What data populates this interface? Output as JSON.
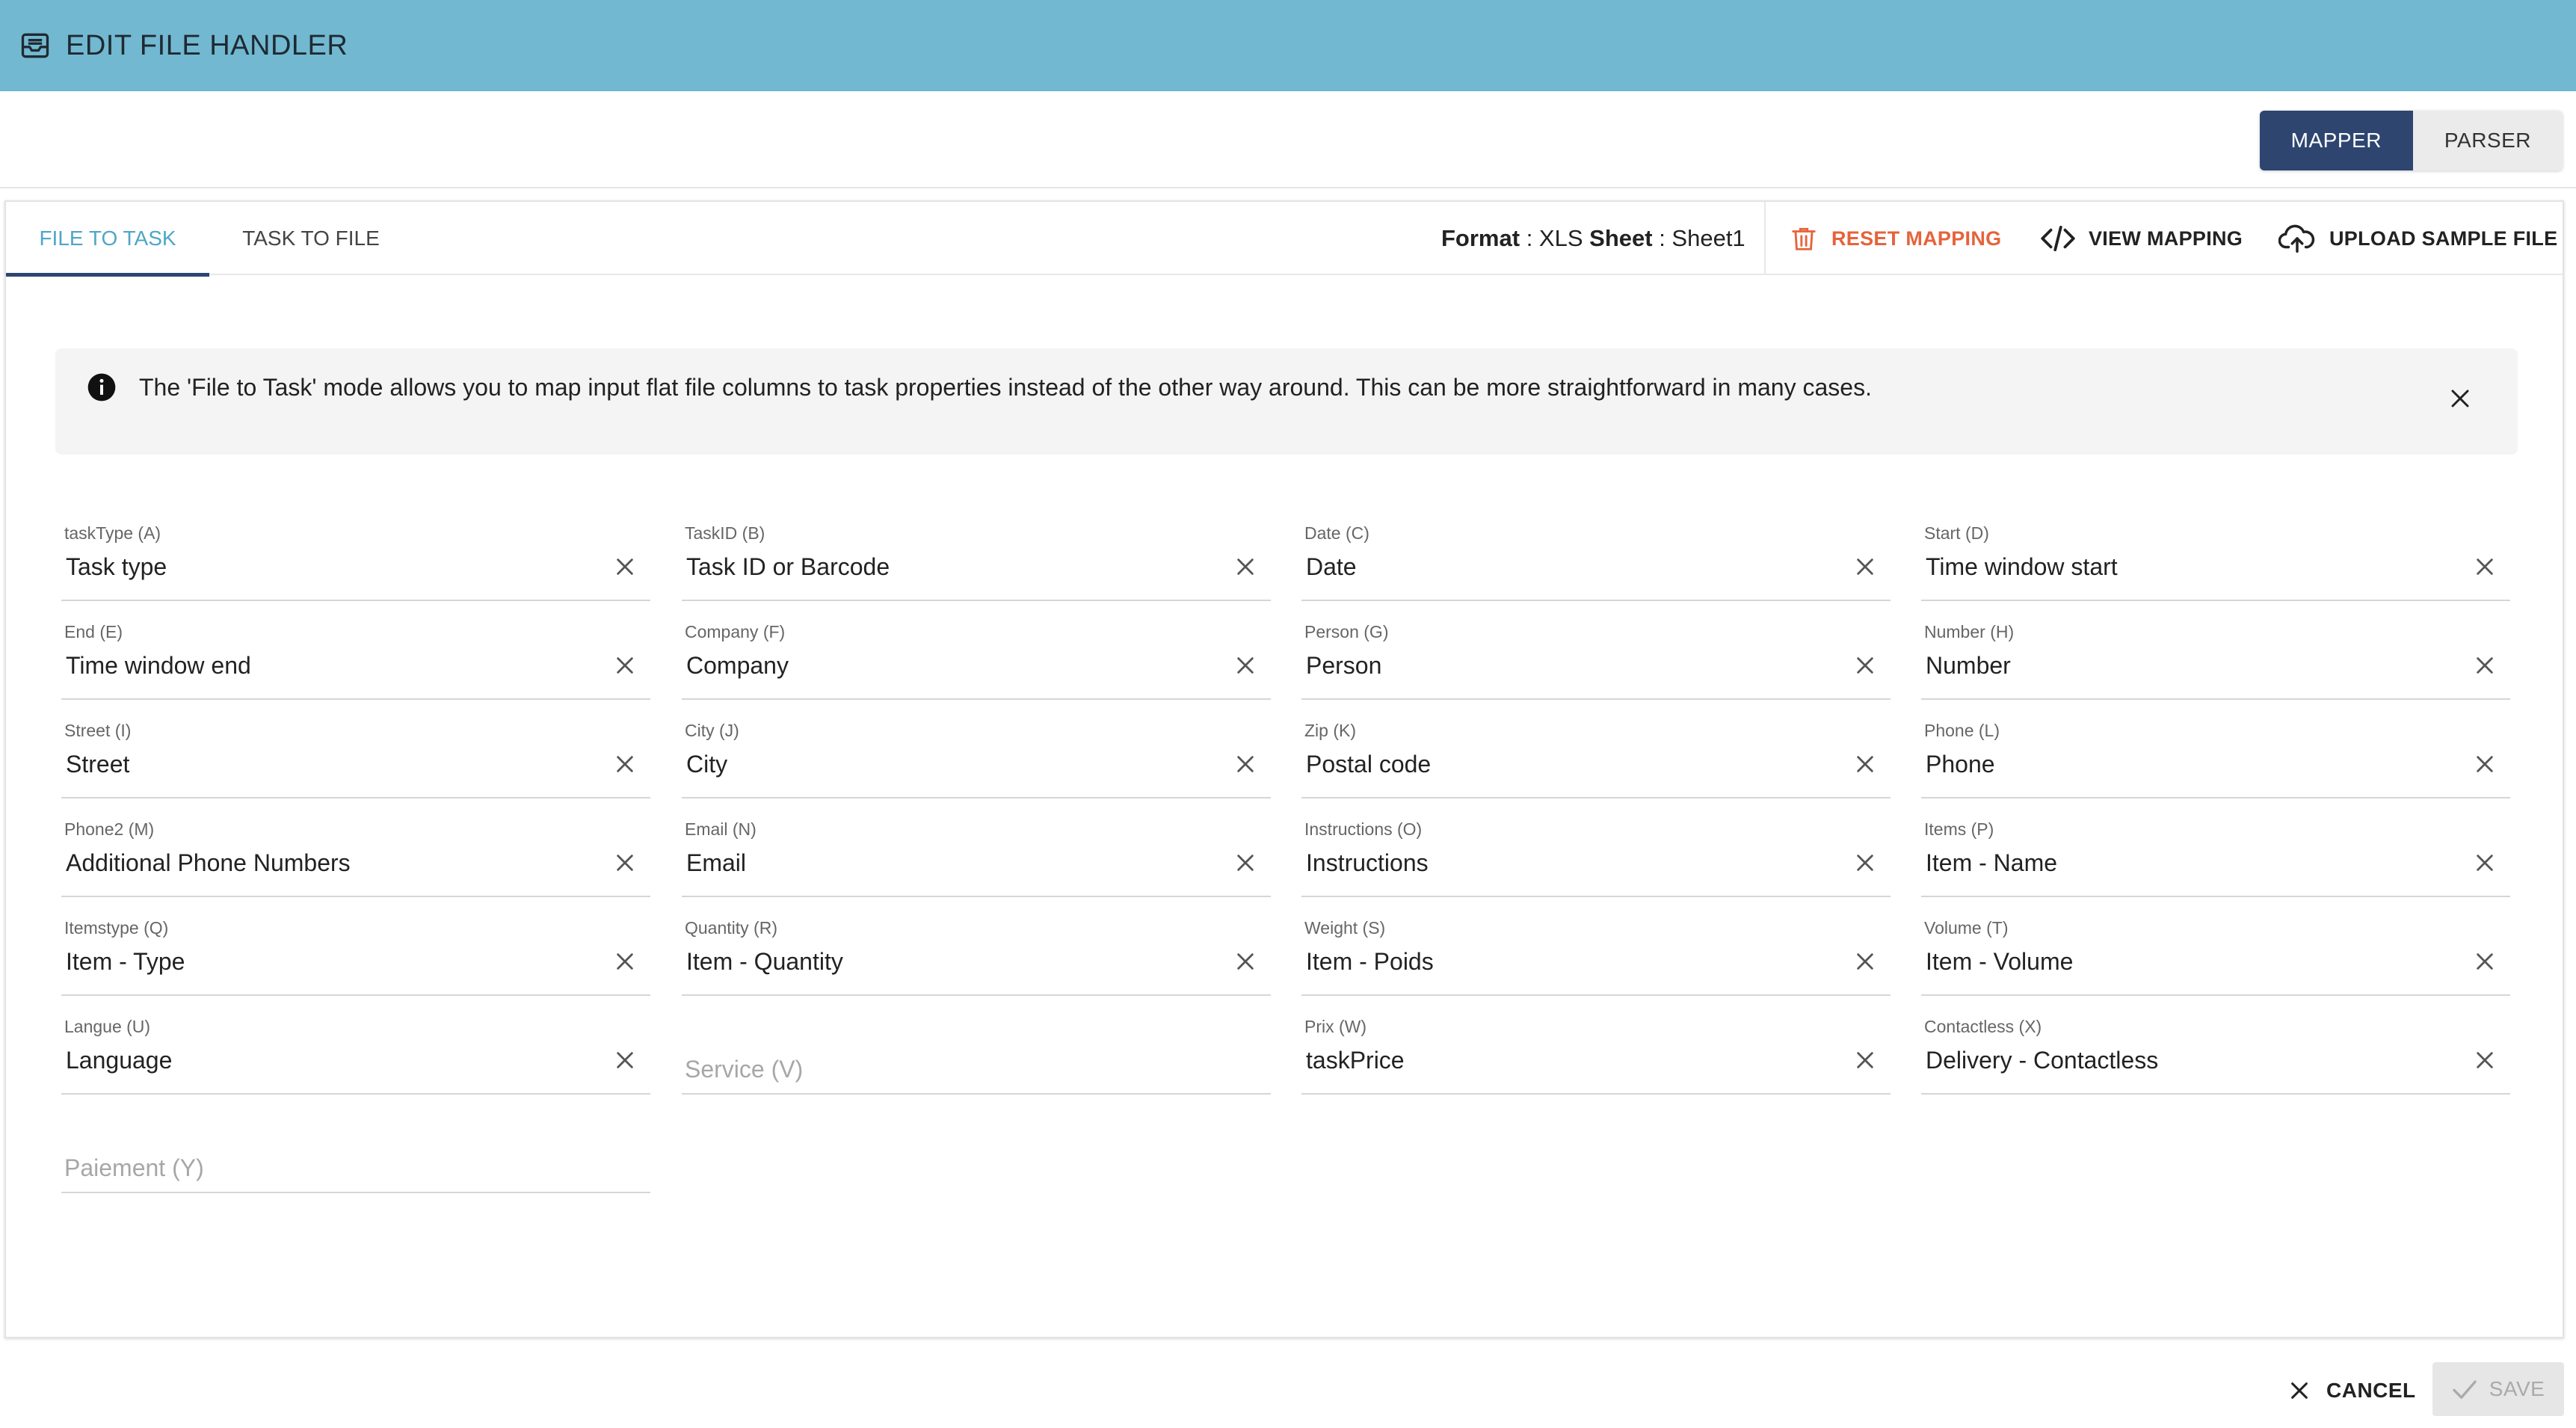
{
  "header": {
    "title": "EDIT FILE HANDLER",
    "icon": "inbox-icon"
  },
  "mode_toggle": {
    "mapper": "MAPPER",
    "parser": "PARSER",
    "active": "MAPPER"
  },
  "tabs": [
    {
      "label": "FILE TO TASK",
      "active": true
    },
    {
      "label": "TASK TO FILE",
      "active": false
    }
  ],
  "format": {
    "format_label": "Format",
    "format_value": "XLS",
    "sheet_label": "Sheet",
    "sheet_value": "Sheet1",
    "separator": " : "
  },
  "actions": {
    "reset": "RESET MAPPING",
    "view": "VIEW MAPPING",
    "upload": "UPLOAD SAMPLE FILE"
  },
  "info_banner": {
    "text": "The 'File to Task' mode allows you to map input flat file columns to task properties instead of the other way around. This can be more straightforward in many cases."
  },
  "fields": [
    {
      "label": "taskType (A)",
      "value": "Task type"
    },
    {
      "label": "TaskID (B)",
      "value": "Task ID or Barcode"
    },
    {
      "label": "Date (C)",
      "value": "Date"
    },
    {
      "label": "Start (D)",
      "value": "Time window start"
    },
    {
      "label": "End (E)",
      "value": "Time window end"
    },
    {
      "label": "Company (F)",
      "value": "Company"
    },
    {
      "label": "Person (G)",
      "value": "Person"
    },
    {
      "label": "Number (H)",
      "value": "Number"
    },
    {
      "label": "Street (I)",
      "value": "Street"
    },
    {
      "label": "City (J)",
      "value": "City"
    },
    {
      "label": "Zip (K)",
      "value": "Postal code"
    },
    {
      "label": "Phone (L)",
      "value": "Phone"
    },
    {
      "label": "Phone2 (M)",
      "value": "Additional Phone Numbers"
    },
    {
      "label": "Email (N)",
      "value": "Email"
    },
    {
      "label": "Instructions (O)",
      "value": "Instructions"
    },
    {
      "label": "Items (P)",
      "value": "Item - Name"
    },
    {
      "label": "Itemstype (Q)",
      "value": "Item - Type"
    },
    {
      "label": "Quantity (R)",
      "value": "Item - Quantity"
    },
    {
      "label": "Weight (S)",
      "value": "Item - Poids"
    },
    {
      "label": "Volume (T)",
      "value": "Item - Volume"
    },
    {
      "label": "Langue (U)",
      "value": "Language"
    },
    {
      "label": "",
      "value": "",
      "placeholder": "Service (V)"
    },
    {
      "label": "Prix (W)",
      "value": "taskPrice"
    },
    {
      "label": "Contactless (X)",
      "value": "Delivery - Contactless"
    },
    {
      "label": "",
      "value": "",
      "placeholder": "Paiement (Y)"
    }
  ],
  "footer": {
    "cancel": "CANCEL",
    "save": "SAVE"
  },
  "colors": {
    "header_bg": "#72b8d0",
    "active_mode": "#2e4570",
    "active_tab": "#4ea6c8",
    "danger": "#e6633b"
  }
}
